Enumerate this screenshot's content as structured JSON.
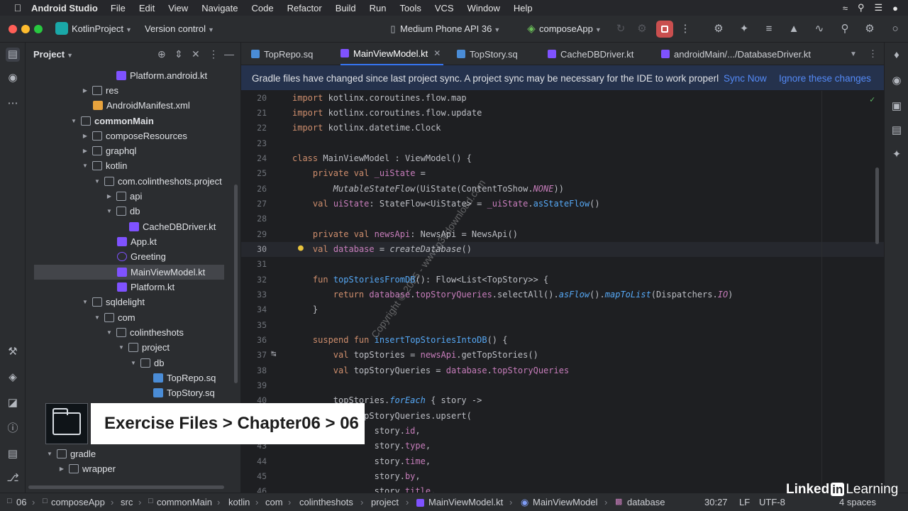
{
  "mac_menu": {
    "app": "Android Studio",
    "items": [
      "File",
      "Edit",
      "View",
      "Navigate",
      "Code",
      "Refactor",
      "Build",
      "Run",
      "Tools",
      "VCS",
      "Window",
      "Help"
    ],
    "status_icons": [
      "wifi-icon",
      "search-icon",
      "control-center-icon",
      "siri-icon"
    ]
  },
  "titlebar": {
    "project": "KotlinProject",
    "vcs": "Version control",
    "device": "Medium Phone API 36",
    "run_config": "composeApp"
  },
  "project_panel": {
    "title": "Project",
    "rows": [
      {
        "label": "Platform.android.kt",
        "icon": "kt"
      },
      {
        "label": "res",
        "icon": "folder"
      },
      {
        "label": "AndroidManifest.xml",
        "icon": "xml"
      },
      {
        "label": "commonMain",
        "icon": "folder"
      },
      {
        "label": "composeResources",
        "icon": "folder"
      },
      {
        "label": "graphql",
        "icon": "folder"
      },
      {
        "label": "kotlin",
        "icon": "folder"
      },
      {
        "label": "com.colintheshots.project",
        "icon": "folder"
      },
      {
        "label": "api",
        "icon": "folder"
      },
      {
        "label": "db",
        "icon": "folder"
      },
      {
        "label": "CacheDBDriver.kt",
        "icon": "kt"
      },
      {
        "label": "App.kt",
        "icon": "kt"
      },
      {
        "label": "Greeting",
        "icon": "greet"
      },
      {
        "label": "MainViewModel.kt",
        "icon": "kt"
      },
      {
        "label": "Platform.kt",
        "icon": "kt"
      },
      {
        "label": "sqldelight",
        "icon": "folder"
      },
      {
        "label": "com",
        "icon": "folder"
      },
      {
        "label": "colintheshots",
        "icon": "folder"
      },
      {
        "label": "project",
        "icon": "folder"
      },
      {
        "label": "db",
        "icon": "folder"
      },
      {
        "label": "TopRepo.sq",
        "icon": "sq"
      },
      {
        "label": "TopStory.sq",
        "icon": "sq"
      },
      {
        "label": "gradle",
        "icon": "folder"
      },
      {
        "label": "wrapper",
        "icon": "folder"
      }
    ]
  },
  "tabs": [
    {
      "label": "TopRepo.sq"
    },
    {
      "label": "MainViewModel.kt"
    },
    {
      "label": "TopStory.sq"
    },
    {
      "label": "CacheDBDriver.kt"
    },
    {
      "label": "androidMain/.../DatabaseDriver.kt"
    }
  ],
  "notice": {
    "message": "Gradle files have changed since last project sync. A project sync may be necessary for the IDE to work properl",
    "sync_now": "Sync Now",
    "ignore": "Ignore these changes"
  },
  "editor": {
    "current_line": "30",
    "lines": [
      {
        "n": "20",
        "code": "import kotlinx.coroutines.flow.map"
      },
      {
        "n": "21",
        "code": "import kotlinx.coroutines.flow.update"
      },
      {
        "n": "22",
        "code": "import kotlinx.datetime.Clock"
      },
      {
        "n": "23",
        "code": ""
      },
      {
        "n": "24",
        "code": "class MainViewModel : ViewModel() {"
      },
      {
        "n": "25",
        "code": "    private val _uiState ="
      },
      {
        "n": "26",
        "code": "        MutableStateFlow(UiState(ContentToShow.NONE))"
      },
      {
        "n": "27",
        "code": "    val uiState: StateFlow<UiState> = _uiState.asStateFlow()"
      },
      {
        "n": "28",
        "code": ""
      },
      {
        "n": "29",
        "code": "    private val newsApi: NewsApi = NewsApi()"
      },
      {
        "n": "30",
        "code": "    val database = createDatabase()"
      },
      {
        "n": "31",
        "code": ""
      },
      {
        "n": "32",
        "code": "    fun topStoriesFromDB(): Flow<List<TopStory>> {"
      },
      {
        "n": "33",
        "code": "        return database.topStoryQueries.selectAll().asFlow().mapToList(Dispatchers.IO)"
      },
      {
        "n": "34",
        "code": "    }"
      },
      {
        "n": "35",
        "code": ""
      },
      {
        "n": "36",
        "code": "    suspend fun insertTopStoriesIntoDB() {"
      },
      {
        "n": "37",
        "code": "        val topStories = newsApi.getTopStories()"
      },
      {
        "n": "38",
        "code": "        val topStoryQueries = database.topStoryQueries"
      },
      {
        "n": "39",
        "code": ""
      },
      {
        "n": "40",
        "code": "        topStories.forEach { story ->"
      },
      {
        "n": "41",
        "code": "            topStoryQueries.upsert("
      },
      {
        "n": "42",
        "code": "                story.id,"
      },
      {
        "n": "43",
        "code": "                story.type,"
      },
      {
        "n": "44",
        "code": "                story.time,"
      },
      {
        "n": "45",
        "code": "                story.by,"
      },
      {
        "n": "46",
        "code": "                story.title,"
      }
    ]
  },
  "status": {
    "breadcrumbs": [
      "06",
      "composeApp",
      "src",
      "commonMain",
      "kotlin",
      "com",
      "colintheshots",
      "project",
      "MainViewModel.kt",
      "MainViewModel",
      "database"
    ],
    "position": "30:27",
    "line_sep": "LF",
    "encoding": "UTF-8",
    "indent": "4 spaces"
  },
  "overlay": {
    "text": "Exercise Files > Chapter06 > 06"
  },
  "watermark": "Copyright © 2025 - www.p30download.com",
  "brand": {
    "linked": "Linked",
    "in": "in",
    "learning": "Learning"
  },
  "colors": {
    "accent": "#3574f0",
    "keyword": "#cf8e6d",
    "function": "#56a8f5",
    "property": "#c77dbb",
    "stop": "#c94f4f"
  }
}
